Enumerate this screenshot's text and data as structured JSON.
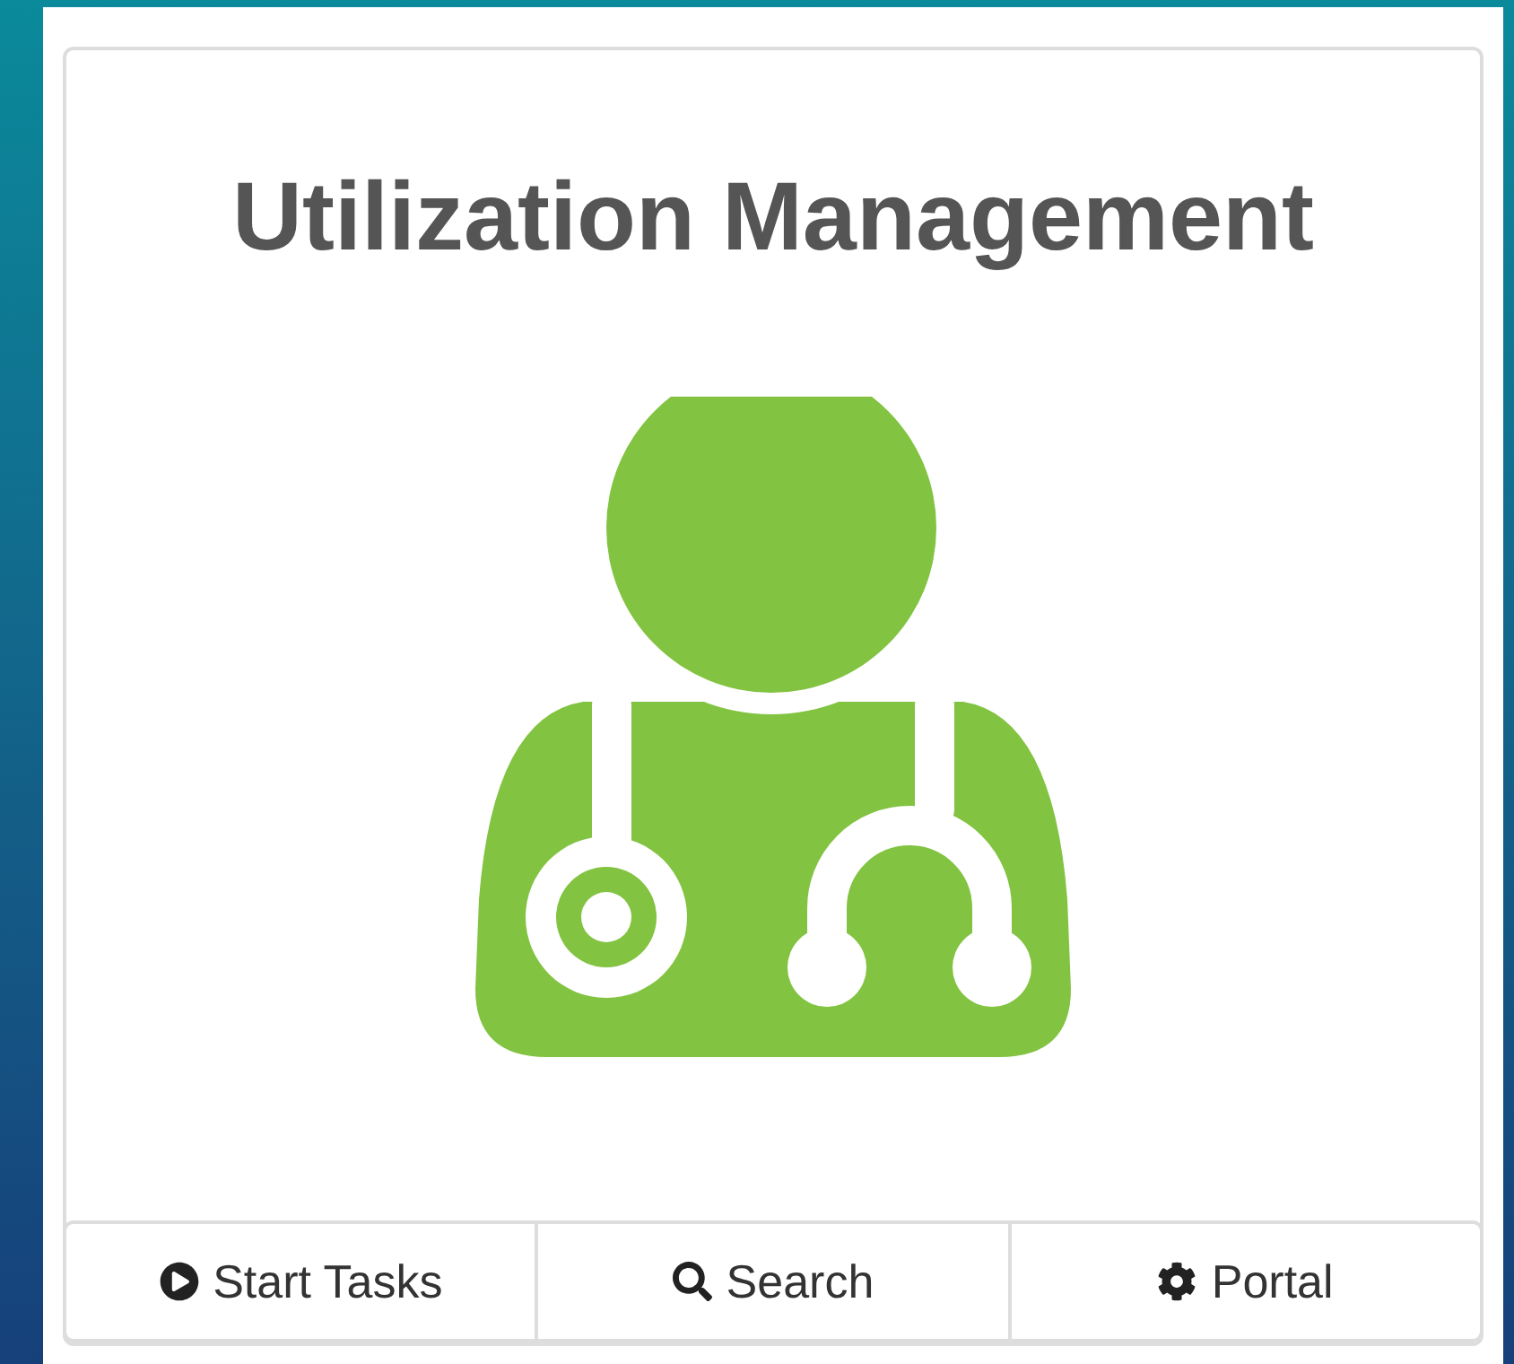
{
  "panel": {
    "title": "Utilization Management"
  },
  "actions": [
    {
      "label": "Start Tasks",
      "kind": "play"
    },
    {
      "label": "Search",
      "kind": "search"
    },
    {
      "label": "Portal",
      "kind": "gear"
    }
  ]
}
